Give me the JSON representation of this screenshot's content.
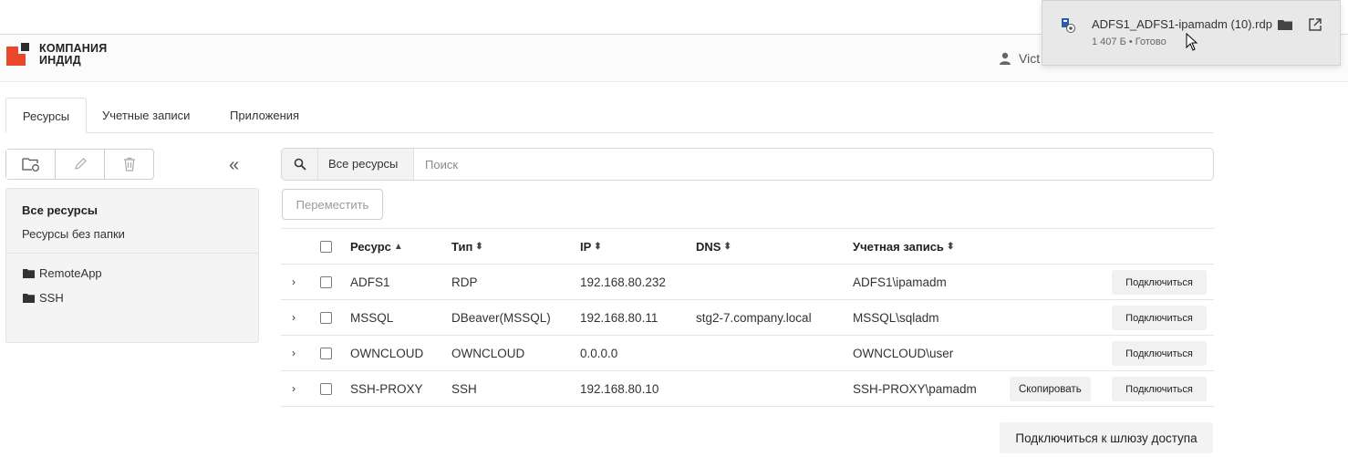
{
  "header": {
    "logo_line1": "КОМПАНИЯ",
    "logo_line2": "ИНДИД",
    "user_name": "Vict",
    "brand_color": "#e8472b"
  },
  "download": {
    "file_name": "ADFS1_ADFS1-ipamadm (10).rdp",
    "meta": "1 407 Б • Готово"
  },
  "tabs": [
    {
      "label": "Ресурсы",
      "active": true
    },
    {
      "label": "Учетные записи",
      "active": false
    },
    {
      "label": "Приложения",
      "active": false
    }
  ],
  "sidebar": {
    "all_resources": "Все ресурсы",
    "no_folder": "Ресурсы без папки",
    "folders": [
      "RemoteApp",
      "SSH"
    ]
  },
  "search": {
    "scope": "Все ресурсы",
    "placeholder": "Поиск",
    "value": ""
  },
  "actions": {
    "move": "Переместить",
    "gateway": "Подключиться к шлюзу доступа"
  },
  "table": {
    "headers": {
      "name": "Ресурс",
      "type": "Тип",
      "ip": "IP",
      "dns": "DNS",
      "account": "Учетная запись"
    },
    "sort_column": "name",
    "rows": [
      {
        "name": "ADFS1",
        "type": "RDP",
        "ip": "192.168.80.232",
        "dns": "",
        "account": "ADFS1\\ipamadm",
        "copy": "",
        "connect": "Подключиться"
      },
      {
        "name": "MSSQL",
        "type": "DBeaver(MSSQL)",
        "ip": "192.168.80.11",
        "dns": "stg2-7.company.local",
        "account": "MSSQL\\sqladm",
        "copy": "",
        "connect": "Подключиться"
      },
      {
        "name": "OWNCLOUD",
        "type": "OWNCLOUD",
        "ip": "0.0.0.0",
        "dns": "",
        "account": "OWNCLOUD\\user",
        "copy": "",
        "connect": "Подключиться"
      },
      {
        "name": "SSH-PROXY",
        "type": "SSH",
        "ip": "192.168.80.10",
        "dns": "",
        "account": "SSH-PROXY\\pamadm",
        "copy": "Скопировать",
        "connect": "Подключиться"
      }
    ]
  }
}
